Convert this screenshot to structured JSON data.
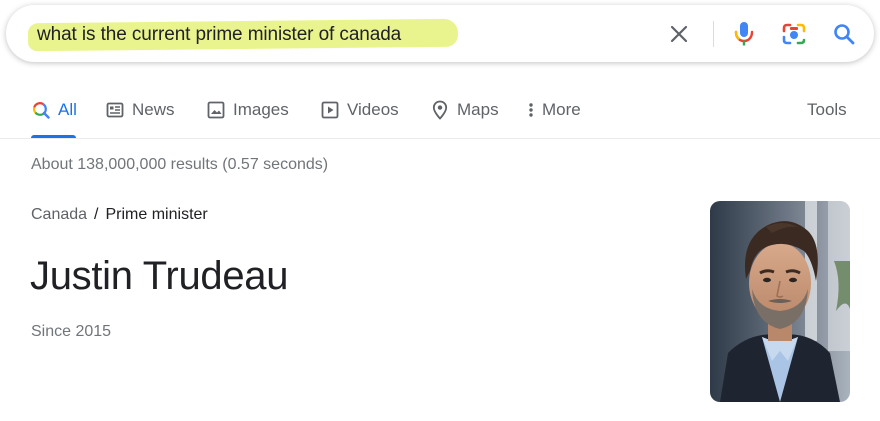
{
  "search": {
    "query": "what is the current prime minister of canada"
  },
  "icons": {
    "clear": "close-icon",
    "mic": "microphone-icon",
    "lens": "camera-lens-icon",
    "search": "search-icon"
  },
  "tabs": [
    {
      "label": "All",
      "icon": "search-icon",
      "active": true
    },
    {
      "label": "News",
      "icon": "newspaper-icon"
    },
    {
      "label": "Images",
      "icon": "image-icon"
    },
    {
      "label": "Videos",
      "icon": "play-icon"
    },
    {
      "label": "Maps",
      "icon": "map-pin-icon"
    },
    {
      "label": "More",
      "icon": "more-vertical-icon"
    }
  ],
  "tools_label": "Tools",
  "results_stats": "About 138,000,000 results (0.57 seconds)",
  "breadcrumb": {
    "parent": "Canada",
    "separator": "/",
    "current": "Prime minister"
  },
  "answer": {
    "title": "Justin Trudeau",
    "subtitle": "Since 2015"
  },
  "colors": {
    "accent": "#1a73e8",
    "highlight": "#e6f27a",
    "muted_text": "#70757a"
  }
}
